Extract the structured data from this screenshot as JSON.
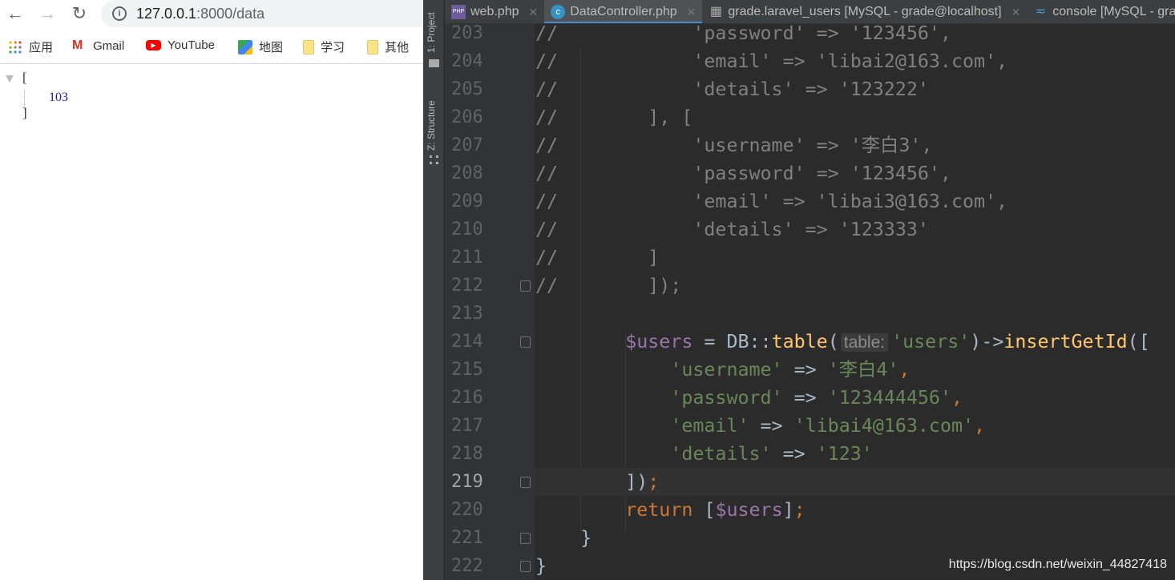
{
  "browser": {
    "url_host": "127.0.0.1",
    "url_rest": ":8000/data",
    "bookmarks": [
      {
        "label": "应用",
        "icon": "apps-grid-icon"
      },
      {
        "label": "Gmail",
        "icon": "gmail-icon"
      },
      {
        "label": "YouTube",
        "icon": "youtube-icon"
      },
      {
        "label": "地图",
        "icon": "maps-icon"
      },
      {
        "label": "学习",
        "icon": "folder-icon"
      },
      {
        "label": "其他",
        "icon": "folder-icon"
      }
    ],
    "json": {
      "open": "[",
      "value": "103",
      "close": "]"
    }
  },
  "ide": {
    "side_tools": [
      "1: Project",
      "Z: Structure"
    ],
    "tabs": [
      {
        "label": "web.php",
        "icon": "php-file-icon",
        "active": false
      },
      {
        "label": "DataController.php",
        "icon": "class-icon",
        "active": true
      },
      {
        "label": "grade.laravel_users [MySQL - grade@localhost]",
        "icon": "table-icon",
        "active": false
      },
      {
        "label": "console [MySQL - grade@localhost]",
        "icon": "console-icon",
        "active": false
      }
    ],
    "current_line": 219,
    "lines": [
      {
        "n": 203,
        "tokens": [
          [
            "comment",
            "//            'password' => '123456',"
          ]
        ]
      },
      {
        "n": 204,
        "tokens": [
          [
            "comment",
            "//            'email' => 'libai2@163.com',"
          ]
        ]
      },
      {
        "n": 205,
        "tokens": [
          [
            "comment",
            "//            'details' => '123222'"
          ]
        ]
      },
      {
        "n": 206,
        "tokens": [
          [
            "comment",
            "//        ], ["
          ]
        ]
      },
      {
        "n": 207,
        "tokens": [
          [
            "comment",
            "//            'username' => '李白3',"
          ]
        ]
      },
      {
        "n": 208,
        "tokens": [
          [
            "comment",
            "//            'password' => '123456',"
          ]
        ]
      },
      {
        "n": 209,
        "tokens": [
          [
            "comment",
            "//            'email' => 'libai3@163.com',"
          ]
        ]
      },
      {
        "n": 210,
        "tokens": [
          [
            "comment",
            "//            'details' => '123333'"
          ]
        ]
      },
      {
        "n": 211,
        "tokens": [
          [
            "comment",
            "//        ]"
          ]
        ]
      },
      {
        "n": 212,
        "fold": true,
        "tokens": [
          [
            "comment",
            "//        ]);"
          ]
        ]
      },
      {
        "n": 213,
        "tokens": []
      },
      {
        "n": 214,
        "fold": true,
        "tokens": [
          [
            "plain",
            "        "
          ],
          [
            "var",
            "$users"
          ],
          [
            "plain",
            " = DB::"
          ],
          [
            "fn",
            "table"
          ],
          [
            "plain",
            "("
          ],
          [
            "hint",
            "table:"
          ],
          [
            "str",
            "'users'"
          ],
          [
            "plain",
            ")->"
          ],
          [
            "fn",
            "insertGetId"
          ],
          [
            "plain",
            "(["
          ]
        ]
      },
      {
        "n": 215,
        "tokens": [
          [
            "plain",
            "            "
          ],
          [
            "str",
            "'username'"
          ],
          [
            "plain",
            " => "
          ],
          [
            "str",
            "'李白4'"
          ],
          [
            "kw",
            ","
          ]
        ]
      },
      {
        "n": 216,
        "tokens": [
          [
            "plain",
            "            "
          ],
          [
            "str",
            "'password'"
          ],
          [
            "plain",
            " => "
          ],
          [
            "str",
            "'123444456'"
          ],
          [
            "kw",
            ","
          ]
        ]
      },
      {
        "n": 217,
        "tokens": [
          [
            "plain",
            "            "
          ],
          [
            "str",
            "'email'"
          ],
          [
            "plain",
            " => "
          ],
          [
            "str",
            "'libai4@163.com'"
          ],
          [
            "kw",
            ","
          ]
        ]
      },
      {
        "n": 218,
        "tokens": [
          [
            "plain",
            "            "
          ],
          [
            "str",
            "'details'"
          ],
          [
            "plain",
            " => "
          ],
          [
            "str",
            "'123'"
          ]
        ]
      },
      {
        "n": 219,
        "fold": true,
        "tokens": [
          [
            "plain",
            "        ]"
          ],
          [
            "plain",
            ")"
          ],
          [
            "kw",
            ";"
          ]
        ]
      },
      {
        "n": 220,
        "tokens": [
          [
            "plain",
            "        "
          ],
          [
            "kw",
            "return"
          ],
          [
            "plain",
            " ["
          ],
          [
            "var",
            "$users"
          ],
          [
            "plain",
            "]"
          ],
          [
            "kw",
            ";"
          ]
        ]
      },
      {
        "n": 221,
        "fold": true,
        "tokens": [
          [
            "plain",
            "    }"
          ]
        ]
      },
      {
        "n": 222,
        "fold": true,
        "tokens": [
          [
            "plain",
            "}"
          ]
        ]
      }
    ],
    "watermark": "https://blog.csdn.net/weixin_44827418"
  }
}
